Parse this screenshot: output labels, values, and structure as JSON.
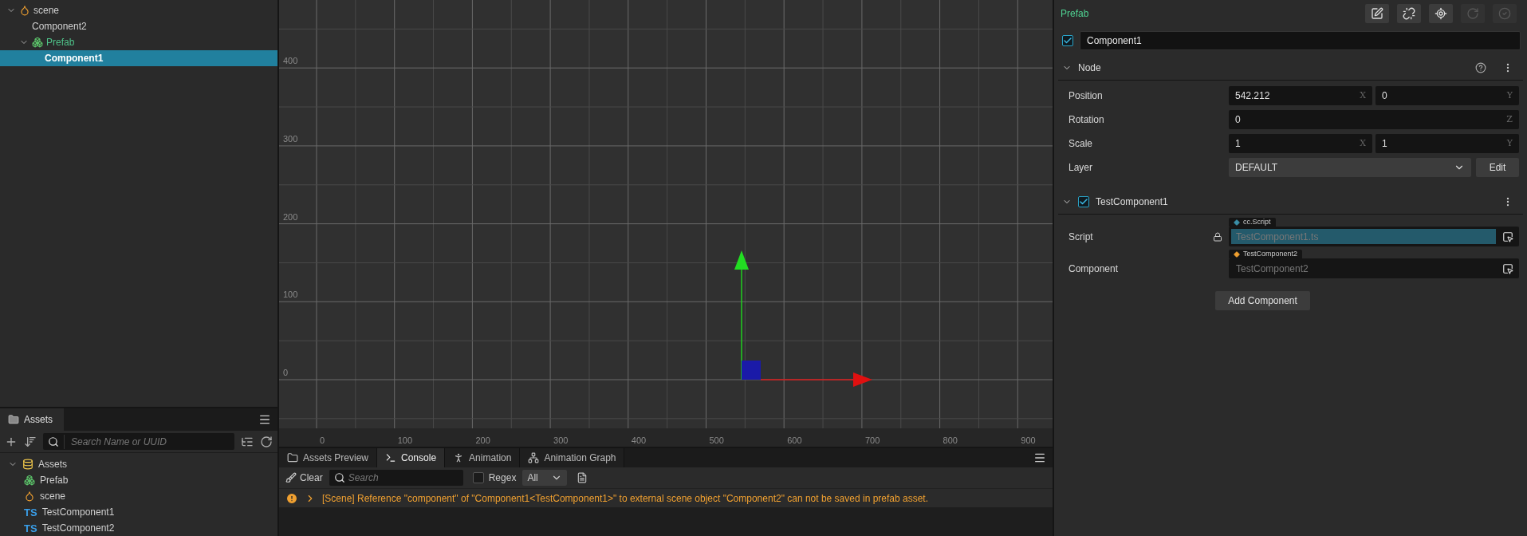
{
  "hierarchy": {
    "nodes": [
      {
        "label": "scene",
        "kind": "scene",
        "expanded": true,
        "selected": false,
        "children": [
          {
            "label": "Component2",
            "selected": false
          },
          {
            "label": "Prefab",
            "kind": "prefab",
            "expanded": true,
            "selected": false,
            "children": [
              {
                "label": "Component1",
                "selected": true
              }
            ]
          }
        ]
      }
    ]
  },
  "assets": {
    "tab": "Assets",
    "search": {
      "placeholder": "Search Name or UUID"
    },
    "tree": [
      {
        "label": "Assets",
        "kind": "folder",
        "expanded": true,
        "children": [
          {
            "label": "Prefab",
            "kind": "prefab"
          },
          {
            "label": "scene",
            "kind": "scene"
          },
          {
            "label": "TestComponent1",
            "kind": "script",
            "badge": "TS"
          },
          {
            "label": "TestComponent2",
            "kind": "script",
            "badge": "TS"
          }
        ]
      }
    ]
  },
  "scene": {
    "y_labels": [
      "400",
      "300",
      "200",
      "100",
      "0"
    ],
    "x_labels": [
      "0",
      "100",
      "200",
      "300",
      "400",
      "500",
      "600",
      "700",
      "800",
      "900"
    ]
  },
  "console": {
    "tabs": [
      {
        "label": "Assets Preview",
        "kind": "preview",
        "selected": false
      },
      {
        "label": "Console",
        "kind": "console",
        "selected": true
      },
      {
        "label": "Animation",
        "kind": "animation",
        "selected": false
      },
      {
        "label": "Animation Graph",
        "kind": "graph",
        "selected": false
      }
    ],
    "clear": "Clear",
    "search": {
      "placeholder": "Search"
    },
    "regex": {
      "label": "Regex",
      "checked": false
    },
    "filter": "All",
    "messages": [
      {
        "kind": "warning",
        "text": "[Scene] Reference \"component\" of \"Component1<TestComponent1>\" to external scene object \"Component2\" can not be saved in prefab asset."
      }
    ]
  },
  "inspector": {
    "title": "Prefab",
    "tools": [
      {
        "kind": "edit",
        "disabled": false
      },
      {
        "kind": "unlink",
        "disabled": false
      },
      {
        "kind": "locate",
        "disabled": false
      },
      {
        "kind": "revert",
        "disabled": true
      },
      {
        "kind": "apply",
        "disabled": true
      }
    ],
    "node_name": "Component1",
    "active": true,
    "node_section": {
      "title": "Node",
      "expanded": true,
      "properties": [
        {
          "label": "Position",
          "kind": "vector",
          "fields": [
            {
              "value": "542.212",
              "axis": "X"
            },
            {
              "value": "0",
              "axis": "Y"
            }
          ]
        },
        {
          "label": "Rotation",
          "kind": "vector",
          "fields": [
            {
              "value": "0",
              "axis": "Z"
            }
          ]
        },
        {
          "label": "Scale",
          "kind": "vector",
          "fields": [
            {
              "value": "1",
              "axis": "X"
            },
            {
              "value": "1",
              "axis": "Y"
            }
          ]
        },
        {
          "label": "Layer",
          "kind": "select",
          "value": "DEFAULT",
          "button": "Edit"
        }
      ]
    },
    "component": {
      "title": "TestComponent1",
      "enabled": true,
      "expanded": true,
      "properties": [
        {
          "label": "Script",
          "kind": "script",
          "locked": true,
          "tag": "cc.Script",
          "value": "TestComponent1.ts"
        },
        {
          "label": "Component",
          "kind": "component",
          "tag": "TestComponent2",
          "value": "TestComponent2"
        }
      ]
    },
    "add_button": "Add Component"
  }
}
